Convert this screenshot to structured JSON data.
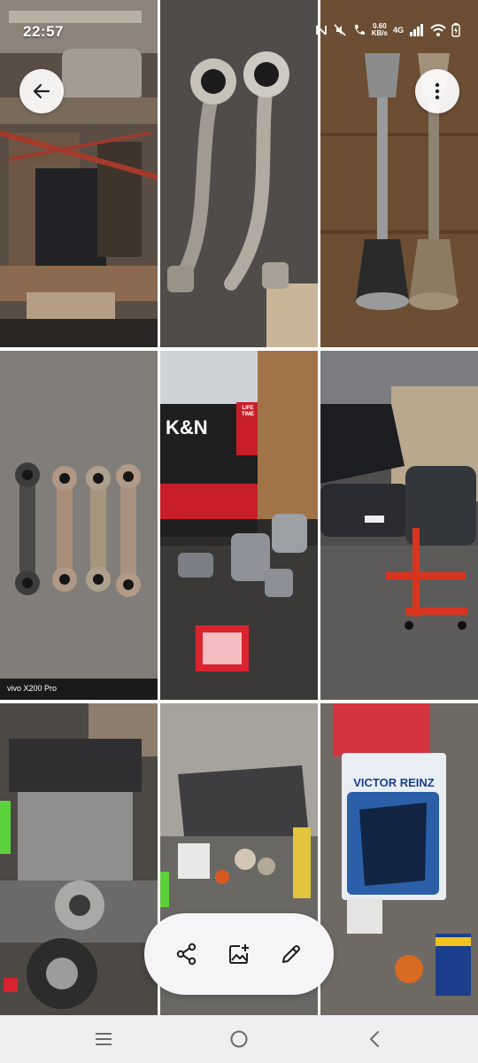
{
  "status_bar": {
    "time": "22:57",
    "net_speed_value": "0.60",
    "net_speed_unit": "KB/s",
    "network_type": "4G"
  },
  "photos": [
    {
      "id": "photo-1",
      "subject": "engine-underside"
    },
    {
      "id": "photo-2",
      "subject": "control-arms"
    },
    {
      "id": "photo-3",
      "subject": "drive-shafts"
    },
    {
      "id": "photo-4",
      "subject": "rear-links",
      "watermark_brand": "vivo X200 Pro"
    },
    {
      "id": "photo-5",
      "subject": "air-filter-bushings",
      "box_brand": "K&N",
      "box_tag": "LIFE TIME"
    },
    {
      "id": "photo-6",
      "subject": "car-and-engine-stand"
    },
    {
      "id": "photo-7",
      "subject": "engine-block"
    },
    {
      "id": "photo-8",
      "subject": "parts-table"
    },
    {
      "id": "photo-9",
      "subject": "gasket-set",
      "box_brand": "VICTOR REINZ"
    }
  ],
  "action_bar": {
    "share_icon": "share-icon",
    "add_image_icon": "add-to-album-icon",
    "edit_icon": "edit-pencil-icon"
  },
  "colors": {
    "pill_background": "#f5f5f7",
    "icon_color": "#1f1f1f",
    "nav_background": "#eeeef0",
    "kn_red": "#d11f2b",
    "victor_reinz_blue": "#1b3f8b"
  }
}
